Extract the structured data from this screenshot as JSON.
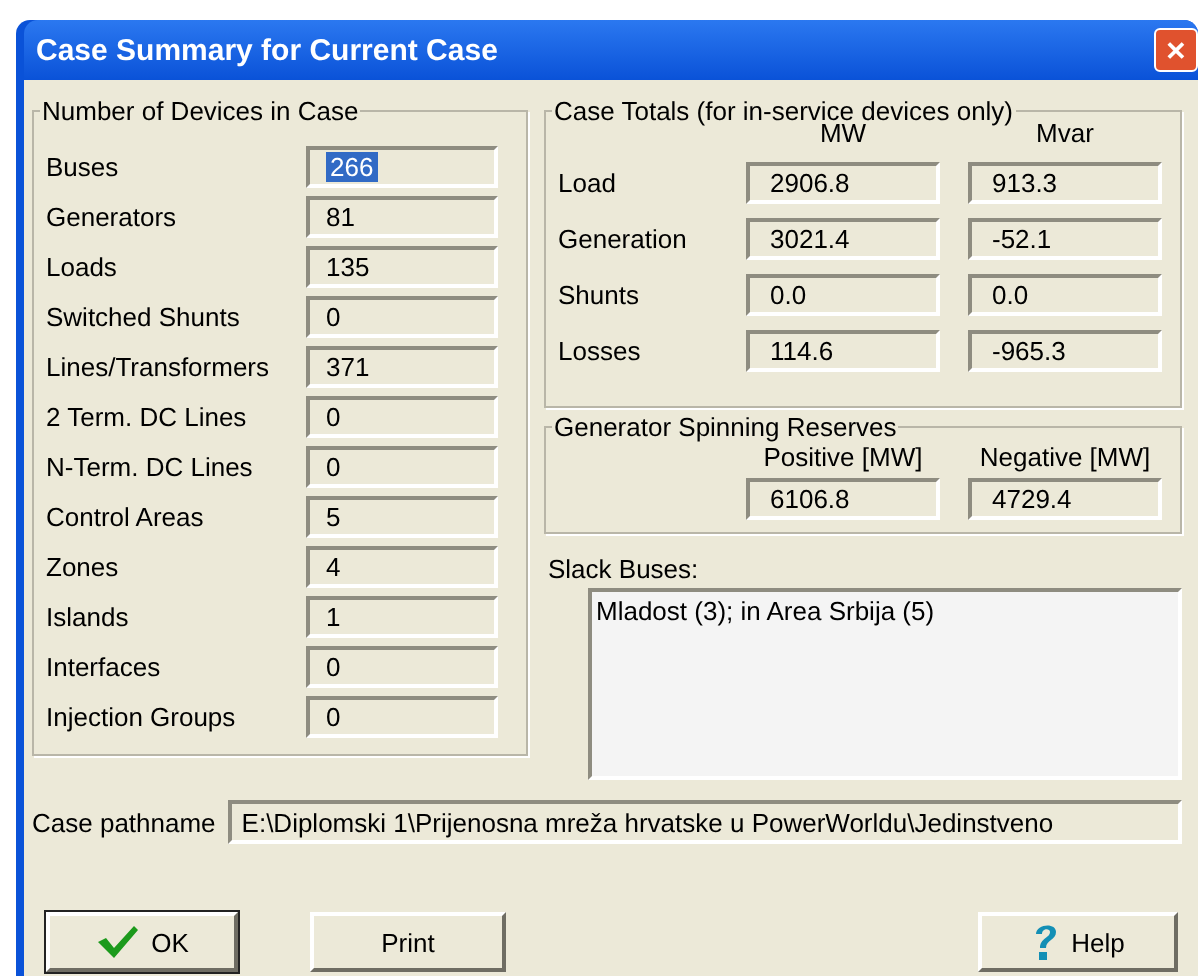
{
  "window": {
    "title": "Case Summary for Current Case",
    "close": "✕"
  },
  "devices": {
    "title": "Number of Devices in Case",
    "items": [
      {
        "label": "Buses",
        "value": "266",
        "selected": true
      },
      {
        "label": "Generators",
        "value": "81",
        "selected": false
      },
      {
        "label": "Loads",
        "value": "135",
        "selected": false
      },
      {
        "label": "Switched Shunts",
        "value": "0",
        "selected": false
      },
      {
        "label": "Lines/Transformers",
        "value": "371",
        "selected": false
      },
      {
        "label": "2 Term. DC Lines",
        "value": "0",
        "selected": false
      },
      {
        "label": "N-Term. DC Lines",
        "value": "0",
        "selected": false
      },
      {
        "label": "Control Areas",
        "value": "5",
        "selected": false
      },
      {
        "label": "Zones",
        "value": "4",
        "selected": false
      },
      {
        "label": "Islands",
        "value": "1",
        "selected": false
      },
      {
        "label": "Interfaces",
        "value": "0",
        "selected": false
      },
      {
        "label": "Injection Groups",
        "value": "0",
        "selected": false
      }
    ]
  },
  "totals": {
    "title": "Case Totals (for in-service devices only)",
    "columns": [
      "MW",
      "Mvar"
    ],
    "rows": [
      {
        "label": "Load",
        "mw": "2906.8",
        "mvar": "913.3"
      },
      {
        "label": "Generation",
        "mw": "3021.4",
        "mvar": "-52.1"
      },
      {
        "label": "Shunts",
        "mw": "0.0",
        "mvar": "0.0"
      },
      {
        "label": "Losses",
        "mw": "114.6",
        "mvar": "-965.3"
      }
    ]
  },
  "reserves": {
    "title": "Generator Spinning Reserves",
    "positive_label": "Positive [MW]",
    "negative_label": "Negative [MW]",
    "positive": "6106.8",
    "negative": "4729.4"
  },
  "slack": {
    "label": "Slack Buses:",
    "value": "Mladost (3); in Area Srbija (5)"
  },
  "pathname": {
    "label": "Case pathname",
    "value": "E:\\Diplomski 1\\Prijenosna mreža hrvatske u PowerWorldu\\Jedinstveno"
  },
  "buttons": [
    {
      "kind": "ok",
      "label": "OK"
    },
    {
      "kind": "print",
      "label": "Print"
    },
    {
      "kind": "help",
      "label": "Help"
    }
  ]
}
